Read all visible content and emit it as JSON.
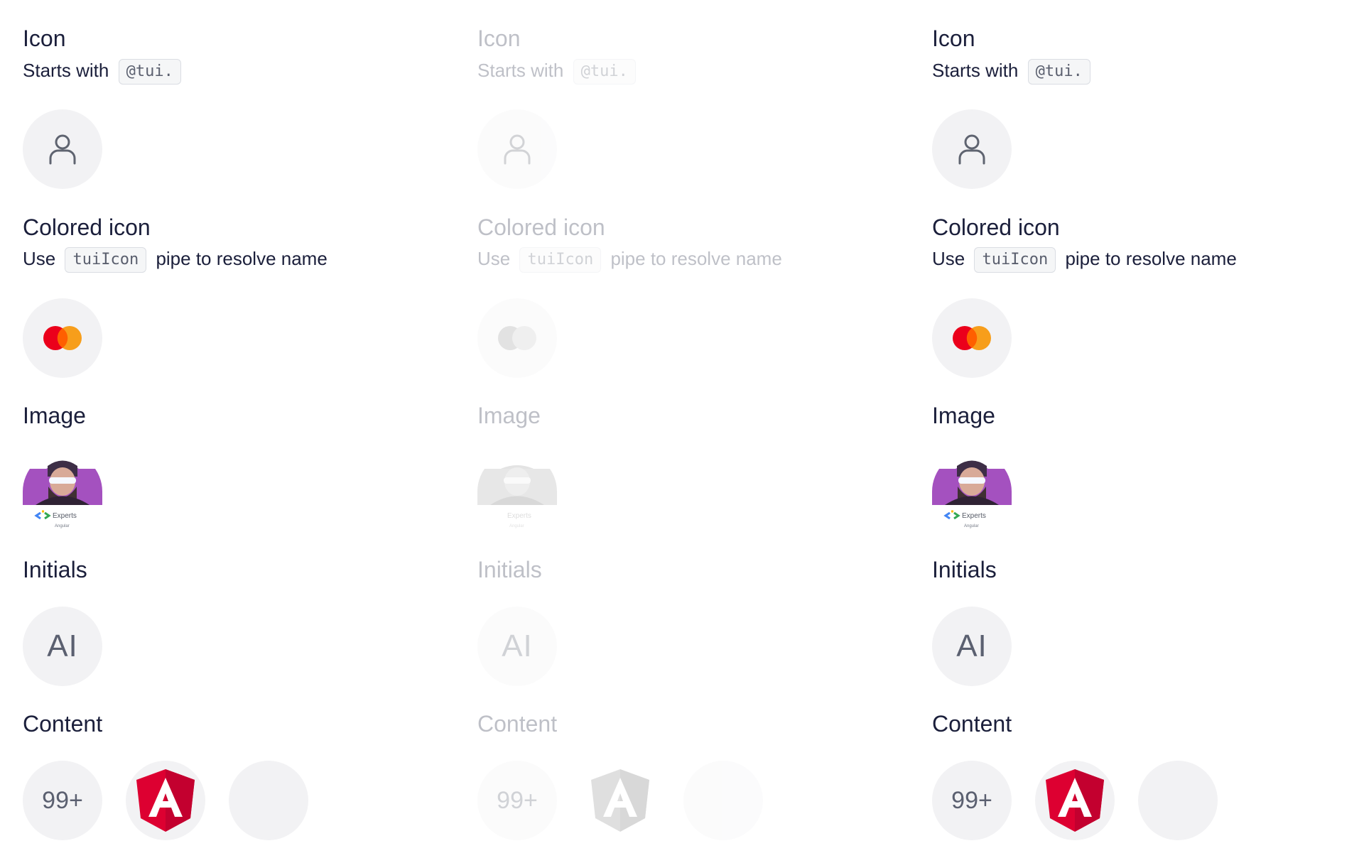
{
  "sections": {
    "icon": {
      "title": "Icon",
      "desc_prefix": "Starts with",
      "desc_code": "@tui.",
      "icon_name": "user-icon"
    },
    "colored": {
      "title": "Colored icon",
      "desc_prefix": "Use",
      "desc_code": "tuiIcon",
      "desc_suffix": "pipe to resolve name",
      "icon_name": "mastercard-icon"
    },
    "image": {
      "title": "Image",
      "photo_caption": "Experts",
      "photo_subcaption": "Angular"
    },
    "initials": {
      "title": "Initials",
      "value": "AI"
    },
    "content": {
      "title": "Content",
      "badge": "99+",
      "logo_name": "angular-logo-icon"
    }
  },
  "colors": {
    "text": "#1b1f3b",
    "avatar_bg": "#f2f2f4",
    "angular_red": "#dd0031",
    "angular_dark_red": "#c3002f",
    "mastercard_red": "#eb001b",
    "mastercard_orange": "#f79e1b"
  },
  "columns": [
    {
      "state": "default"
    },
    {
      "state": "disabled"
    },
    {
      "state": "default"
    }
  ]
}
